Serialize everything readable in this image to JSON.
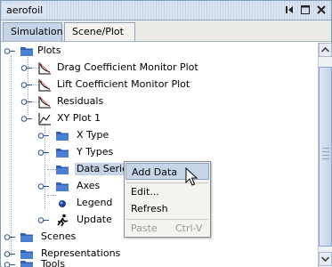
{
  "window": {
    "title": "aerofoil"
  },
  "tabs": [
    {
      "label": "Simulation",
      "selected": true
    },
    {
      "label": "Scene/Plot",
      "selected": false
    }
  ],
  "tree": {
    "plots": "Plots",
    "drag": "Drag Coefficient Monitor Plot",
    "lift": "Lift Coefficient Monitor Plot",
    "residuals": "Residuals",
    "xy": "XY Plot 1",
    "xtype": "X Type",
    "ytypes": "Y Types",
    "dataseries": "Data Series",
    "axes": "Axes",
    "legend": "Legend",
    "update": "Update",
    "scenes": "Scenes",
    "representations": "Representations",
    "tools": "Tools"
  },
  "context_menu": {
    "add_data": "Add Data",
    "edit": "Edit...",
    "refresh": "Refresh",
    "paste": "Paste",
    "paste_shortcut": "Ctrl-V"
  },
  "icons": {
    "folder": "folder-icon",
    "plot": "plot-icon",
    "legend": "legend-icon",
    "update": "running-man-icon",
    "expanded_handle": "expanded-handle-icon",
    "collapsed_handle": "collapsed-handle-icon"
  },
  "colors": {
    "selection": "#c6d4e8",
    "folder_blue": "#2f5fb5",
    "border": "#8ea3c4"
  }
}
